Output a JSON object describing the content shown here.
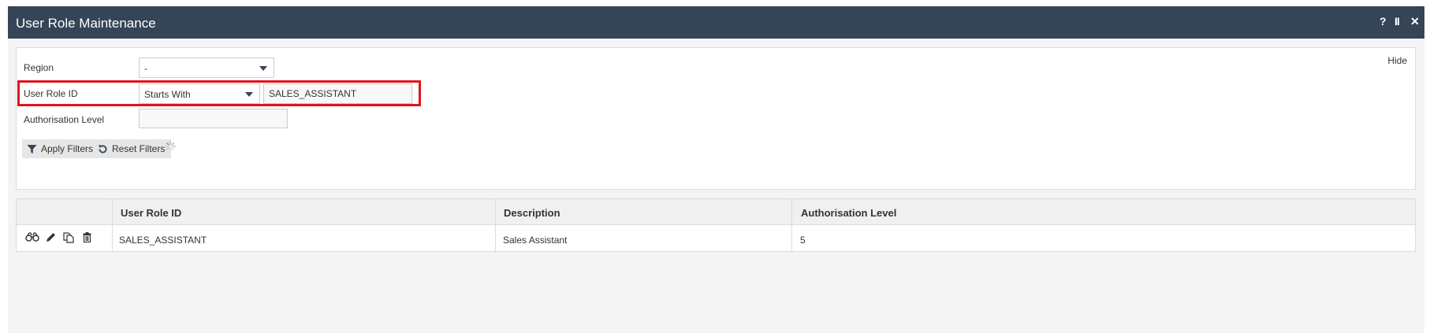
{
  "window": {
    "title": "User Role Maintenance",
    "controls": {
      "help": "?",
      "pause": "II",
      "close": "✕"
    }
  },
  "filters": {
    "hide_label": "Hide",
    "region": {
      "label": "Region",
      "value": "-"
    },
    "user_role_id": {
      "label": "User Role ID",
      "operator": "Starts With",
      "value": "SALES_ASSISTANT"
    },
    "authorisation_level": {
      "label": "Authorisation Level",
      "value": ""
    },
    "apply_label": "Apply Filters",
    "reset_label": "Reset Filters"
  },
  "grid": {
    "columns": [
      "User Role ID",
      "Description",
      "Authorisation Level"
    ],
    "rows": [
      {
        "user_role_id": "SALES_ASSISTANT",
        "description": "Sales Assistant",
        "authorisation_level": "5"
      }
    ],
    "row_actions": [
      "binoculars-icon",
      "pencil-icon",
      "copy-icon",
      "trash-icon"
    ]
  },
  "colors": {
    "titlebar": "#354457",
    "highlight": "#e0141e"
  }
}
